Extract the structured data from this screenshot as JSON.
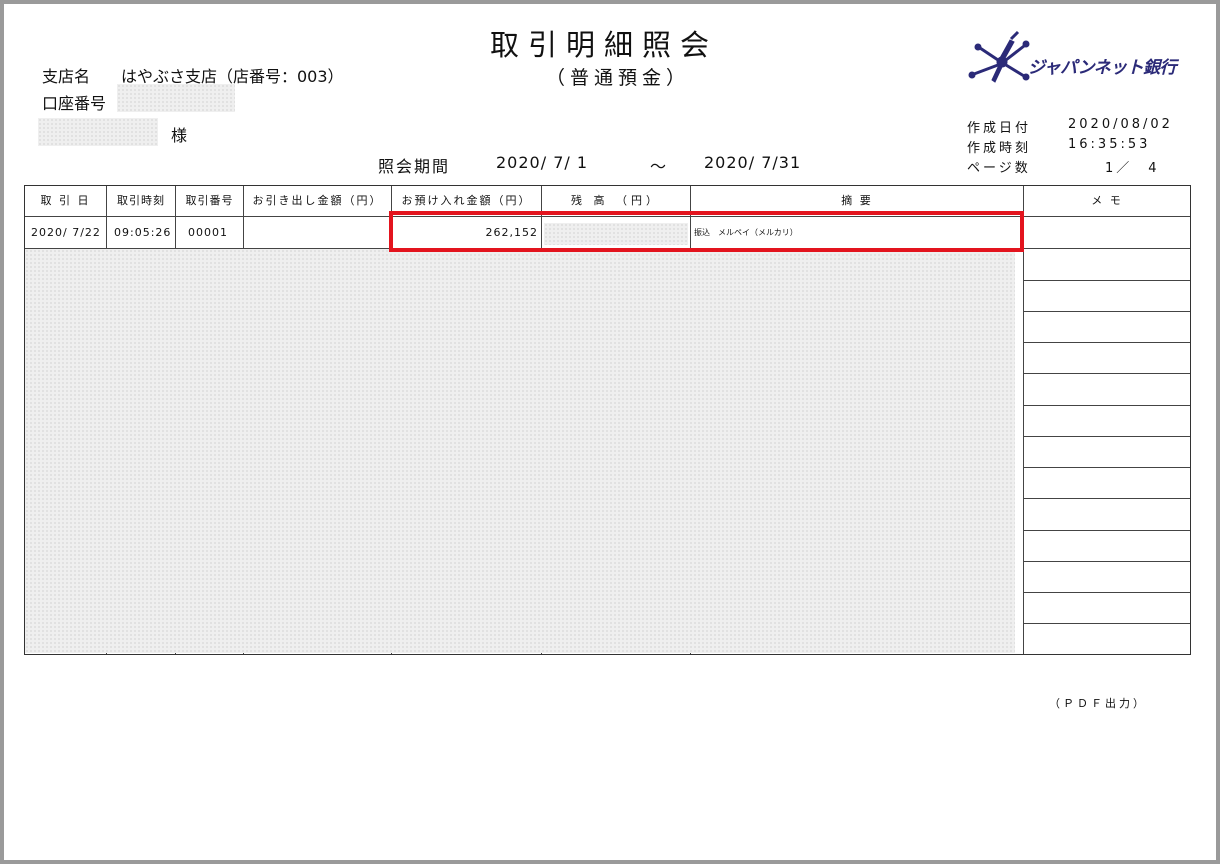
{
  "document": {
    "title": "取引明細照会",
    "subtitle": "（普通預金）",
    "branch_label": "支店名",
    "branch_value": "はやぶさ支店（店番号：003）",
    "account_label": "口座番号",
    "honorific": "様",
    "period_label": "照会期間",
    "period_from": "2020/ 7/ 1",
    "period_tilde": "～",
    "period_to": "2020/ 7/31",
    "footer": "（ＰＤＦ出力）"
  },
  "bank": {
    "name": "ジャパンネット銀行",
    "logo_icon": "dragonfly-icon",
    "brand_color": "#2b2a78"
  },
  "meta": {
    "created_date_label": "作成日付",
    "created_date": "2020/08/02",
    "created_time_label": "作成時刻",
    "created_time": "16:35:53",
    "pages_label": "ページ数",
    "pages": "1／　4"
  },
  "table": {
    "headers": [
      "取 引 日",
      "取引時刻",
      "取引番号",
      "お引き出し金額（円）",
      "お預け入れ金額（円）",
      "残 高 （円）",
      "摘 要",
      "メ モ"
    ],
    "rows": [
      {
        "date": "2020/ 7/22",
        "time": "09:05:26",
        "number": "00001",
        "withdrawal": "",
        "deposit": "262,152",
        "description": "振込　メルペイ（メルカリ）"
      }
    ]
  },
  "colors": {
    "highlight": "#e3141e",
    "frame": "#9a9a9a"
  }
}
